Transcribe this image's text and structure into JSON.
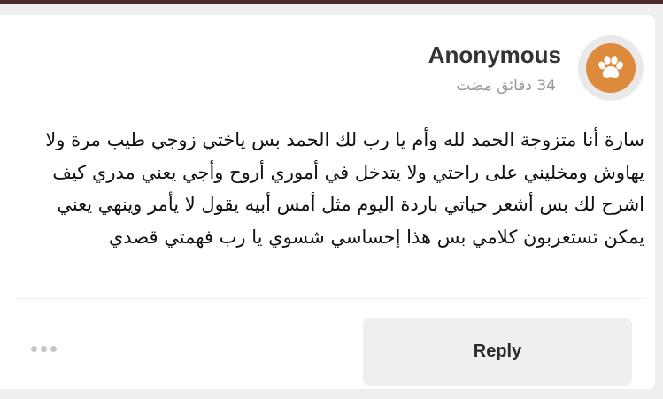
{
  "comment": {
    "author": "Anonymous",
    "timestamp": "34 دقائق مضت",
    "avatar_icon": "paw-icon",
    "avatar_color": "#de8a3c",
    "body": "سارة أنا متزوجة الحمد لله وأم يا رب لك الحمد بس ياختي زوجي طيب مرة ولا يهاوش ومخليني على راحتي ولا يتدخل في أموري أروح وأجي يعني مدري كيف اشرح لك بس أشعر حياتي باردة اليوم مثل أمس أبيه يقول لا يأمر وينهي يعني يمكن تستغربون كلامي بس هذا إحساسي شسوي يا رب فهمتي قصدي"
  },
  "actions": {
    "more_icon": "more-dots-icon",
    "reply_label": "Reply"
  }
}
